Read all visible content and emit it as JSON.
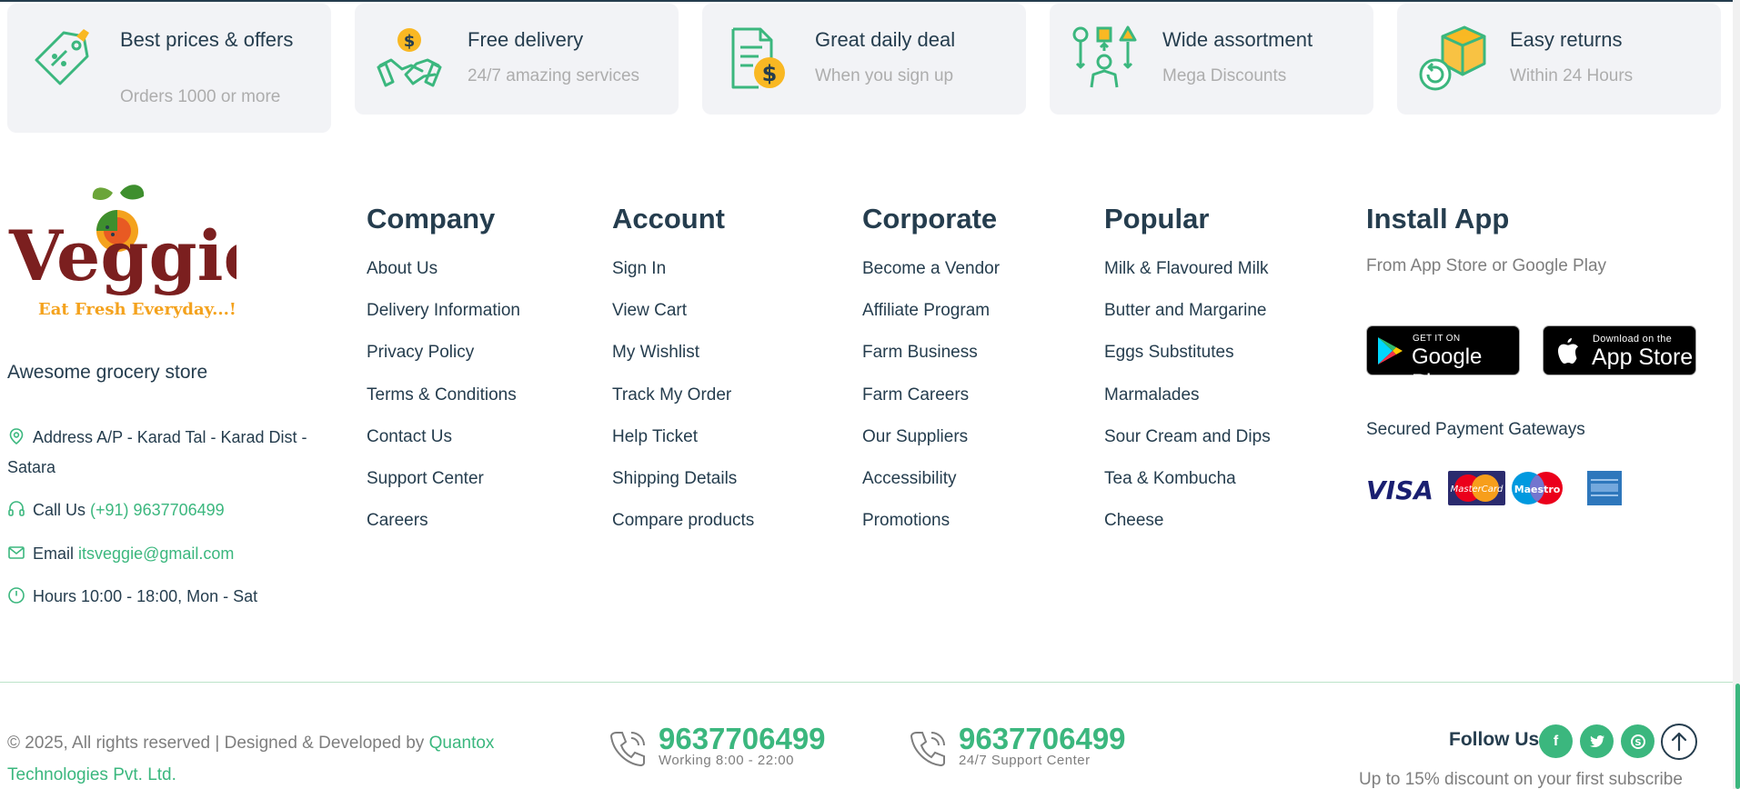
{
  "banners": [
    {
      "title": "Best prices & offers",
      "subtitle": "Orders 1000 or more",
      "icon": "price-tag-icon"
    },
    {
      "title": "Free delivery",
      "subtitle": "24/7 amazing services",
      "icon": "handshake-dollar-icon"
    },
    {
      "title": "Great daily deal",
      "subtitle": "When you sign up",
      "icon": "document-dollar-icon"
    },
    {
      "title": "Wide assortment",
      "subtitle": "Mega Discounts",
      "icon": "assortment-shapes-icon"
    },
    {
      "title": "Easy returns",
      "subtitle": "Within 24 Hours",
      "icon": "return-box-icon"
    }
  ],
  "brand": {
    "logo_text": "Veggie",
    "logo_tagline": "Eat Fresh Everyday...!",
    "tagline": "Awesome grocery store"
  },
  "contact": {
    "address_label": "Address",
    "address_value": "A/P - Karad Tal - Karad Dist - Satara",
    "call_label": "Call Us",
    "call_value": "(+91) 9637706499",
    "email_label": "Email",
    "email_value": "itsveggie@gmail.com",
    "hours_label": "Hours",
    "hours_value": "10:00 - 18:00, Mon - Sat"
  },
  "columns": {
    "company": {
      "title": "Company",
      "links": [
        "About Us",
        "Delivery Information",
        "Privacy Policy",
        "Terms & Conditions",
        "Contact Us",
        "Support Center",
        "Careers"
      ]
    },
    "account": {
      "title": "Account",
      "links": [
        "Sign In",
        "View Cart",
        "My Wishlist",
        "Track My Order",
        "Help Ticket",
        "Shipping Details",
        "Compare products"
      ]
    },
    "corporate": {
      "title": "Corporate",
      "links": [
        "Become a Vendor",
        "Affiliate Program",
        "Farm Business",
        "Farm Careers",
        "Our Suppliers",
        "Accessibility",
        "Promotions"
      ]
    },
    "popular": {
      "title": "Popular",
      "links": [
        "Milk & Flavoured Milk",
        "Butter and Margarine",
        "Eggs Substitutes",
        "Marmalades",
        "Sour Cream and Dips",
        "Tea & Kombucha",
        "Cheese"
      ]
    }
  },
  "install_app": {
    "title": "Install App",
    "subtitle": "From App Store or Google Play",
    "google_small": "GET IT ON",
    "google_big": "Google Play",
    "apple_small": "Download on the",
    "apple_big": "App Store",
    "secured_label": "Secured Payment Gateways",
    "payment_icons": [
      "visa-icon",
      "mastercard-icon",
      "maestro-icon",
      "amex-icon"
    ],
    "visa_text": "VISA",
    "mastercard_text": "MasterCard",
    "maestro_text": "Maestro"
  },
  "bottom": {
    "copyright": "© 2025, All rights reserved | Designed & Developed by",
    "developer": "Quantox Technologies Pvt. Ltd.",
    "hotline1_number": "9637706499",
    "hotline1_label": "Working 8:00 - 22:00",
    "hotline2_number": "9637706499",
    "hotline2_label": "24/7 Support Center",
    "follow_label": "Follow Us",
    "promo": "Up to 15% discount on your first subscribe"
  },
  "colors": {
    "brand_green": "#3BB77E",
    "heading": "#253D4E",
    "muted": "#7E7E7E",
    "banner_bg": "#F2F3F6",
    "logo_red": "#7B1F1F",
    "logo_orange": "#F4A21D"
  }
}
